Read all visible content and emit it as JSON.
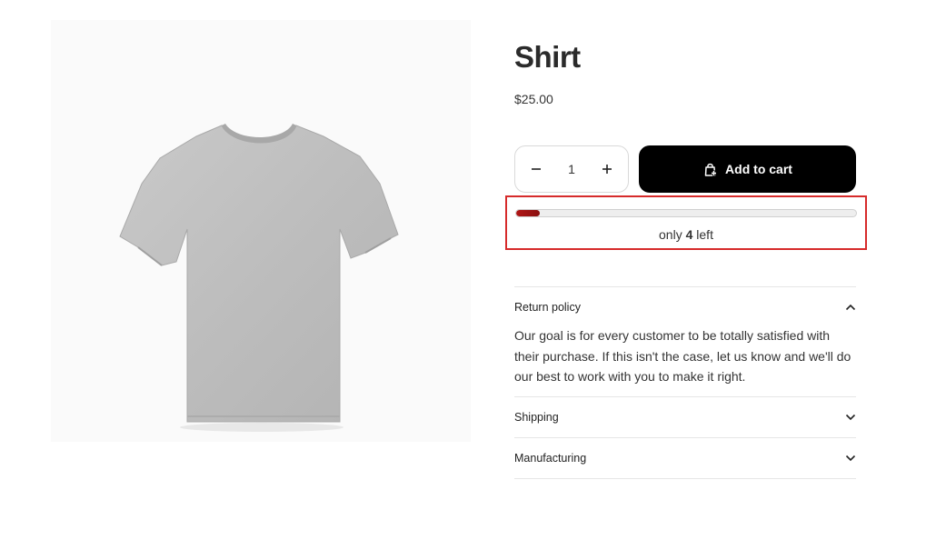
{
  "product": {
    "title": "Shirt",
    "price": "$25.00",
    "image_icon": "tshirt-image"
  },
  "quantity": {
    "value": "1",
    "decrement_icon": "minus-icon",
    "increment_icon": "plus-icon"
  },
  "cart": {
    "label": "Add to cart",
    "icon": "shopping-bag-add-icon",
    "background": "#000000"
  },
  "stock": {
    "prefix": "only",
    "count": "4",
    "suffix": "left",
    "fill_fraction": 0.07,
    "bar_color": "#b01515",
    "highlight_color": "#d62b2b"
  },
  "accordion": [
    {
      "title": "Return policy",
      "expanded": true,
      "icon": "chevron-up-icon",
      "body": "Our goal is for every customer to be totally satisfied with their purchase. If this isn't the case, let us know and we'll do our best to work with you to make it right."
    },
    {
      "title": "Shipping",
      "expanded": false,
      "icon": "chevron-down-icon"
    },
    {
      "title": "Manufacturing",
      "expanded": false,
      "icon": "chevron-down-icon"
    }
  ]
}
